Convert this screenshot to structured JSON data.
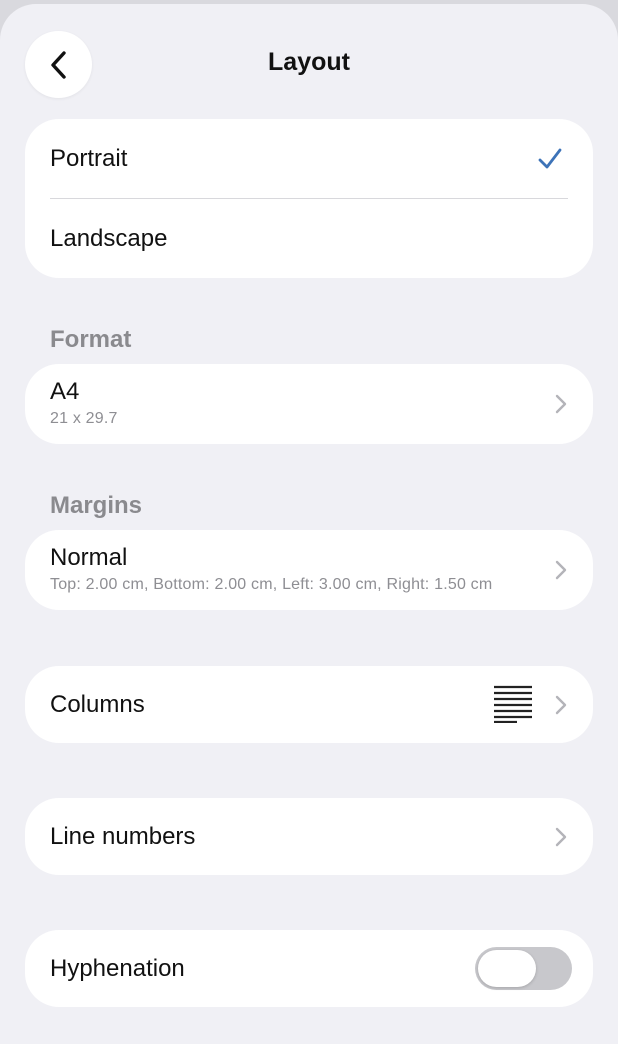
{
  "header": {
    "title": "Layout",
    "back_icon": "chevron-left-icon"
  },
  "orientation": {
    "options": [
      {
        "label": "Portrait",
        "selected": true
      },
      {
        "label": "Landscape",
        "selected": false
      }
    ],
    "check_color": "#3d73b8"
  },
  "format": {
    "section_title": "Format",
    "value": "A4",
    "detail": "21 x 29.7"
  },
  "margins": {
    "section_title": "Margins",
    "value": "Normal",
    "detail": "Top: 2.00 cm, Bottom: 2.00 cm, Left: 3.00 cm, Right: 1.50 cm"
  },
  "columns": {
    "label": "Columns",
    "icon": "columns-lines-icon"
  },
  "line_numbers": {
    "label": "Line numbers"
  },
  "hyphenation": {
    "label": "Hyphenation",
    "enabled": false
  }
}
